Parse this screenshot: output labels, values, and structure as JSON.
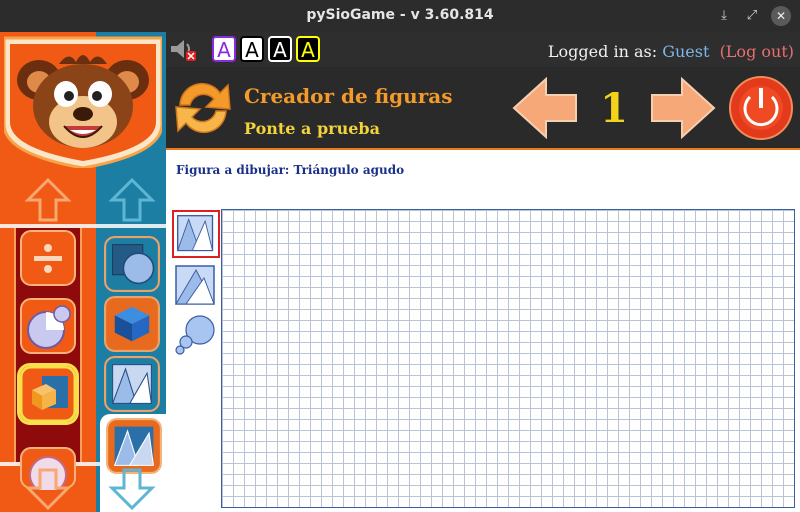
{
  "window": {
    "title": "pySioGame - v 3.60.814",
    "minimize_icon": "download-icon",
    "maximize_icon": "expand-icon",
    "close_icon": "close-icon"
  },
  "topbar": {
    "speaker_icon": "speaker-muted-icon",
    "font_buttons": [
      "A",
      "A",
      "A",
      "A"
    ],
    "logged_in_label": "Logged in as:",
    "user": "Guest",
    "logout": "(Log out)"
  },
  "header": {
    "title": "Creador de figuras",
    "subtitle": "Ponte a prueba",
    "level": "1",
    "colors": {
      "title": "#f39a2a",
      "subtitle": "#f2d33a",
      "level": "#f2d319"
    }
  },
  "sidebar": {
    "col1_items": [
      "divide-icon",
      "fraction-circle-icon",
      "cube-shapes-icon",
      "clock-icon"
    ],
    "col2_items": [
      "square-circle-icon",
      "3d-cube-icon",
      "shapes-drawing-icon",
      "shape-maker-icon"
    ],
    "selected": "shape-maker-icon"
  },
  "main": {
    "prompt": "Figura a dibujar: Triángulo agudo",
    "tools": [
      "rectangle-tool-icon",
      "triangle-tool-icon",
      "circle-tool-icon"
    ],
    "selected_tool": "rectangle-tool-icon"
  }
}
